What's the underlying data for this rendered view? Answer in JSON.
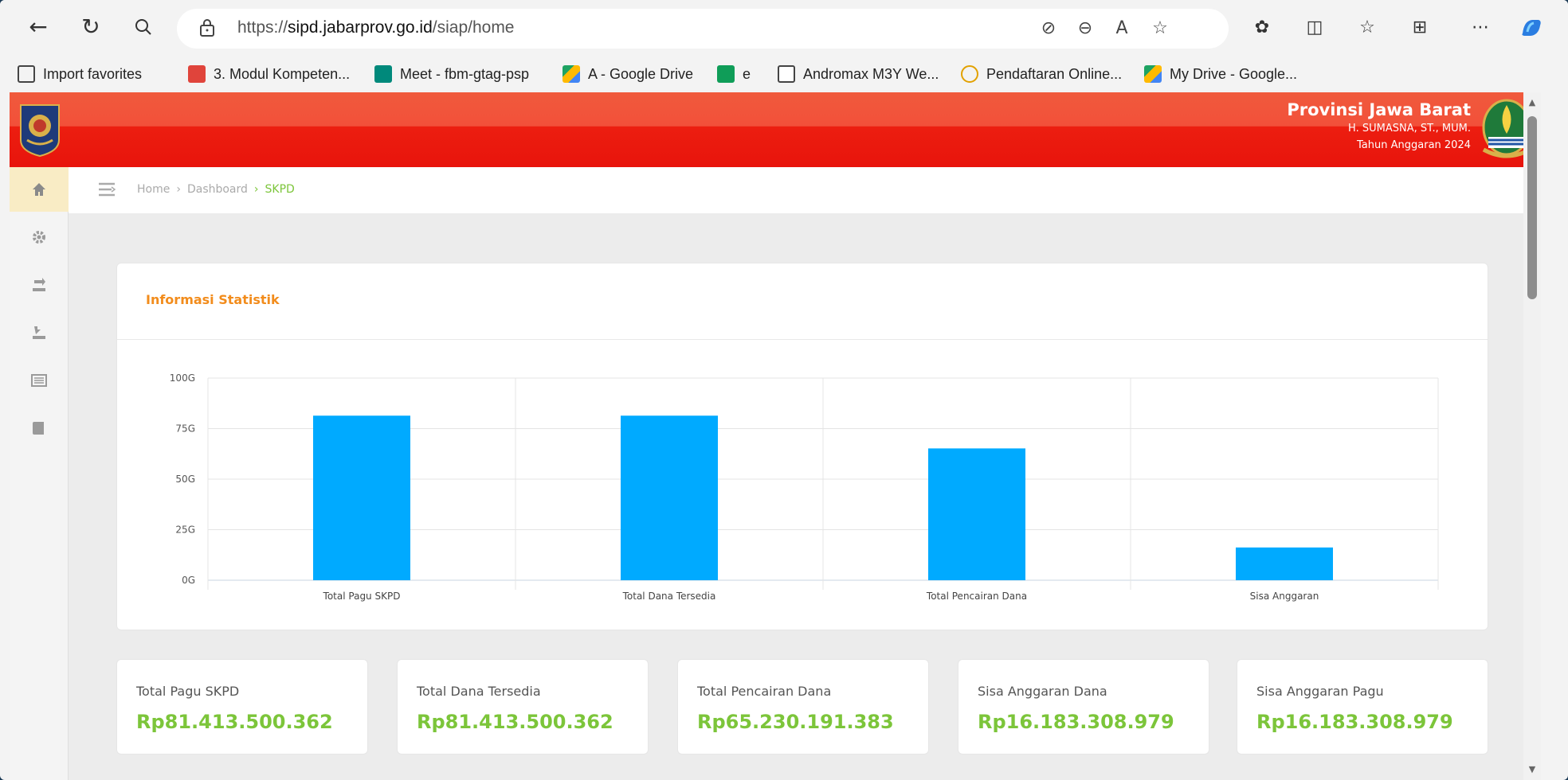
{
  "browser": {
    "url_prefix": "https://",
    "url_domain": "sipd.jabarprov.go.id",
    "url_path": "/siap/home",
    "bookmarks": [
      {
        "label": "Import favorites",
        "icon": "import-icon"
      },
      {
        "label": "3. Modul Kompeten...",
        "icon": "pdf-icon"
      },
      {
        "label": "Meet - fbm-gtag-psp",
        "icon": "meet-icon"
      },
      {
        "label": "A - Google Drive",
        "icon": "drive-icon"
      },
      {
        "label": "e",
        "icon": "sheets-icon"
      },
      {
        "label": "Andromax M3Y We...",
        "icon": "page-icon"
      },
      {
        "label": "Pendaftaran Online...",
        "icon": "site-icon"
      },
      {
        "label": "My Drive - Google...",
        "icon": "drive-icon"
      }
    ]
  },
  "header": {
    "province": "Provinsi Jawa Barat",
    "user": "H. SUMASNA, ST., MUM.",
    "fiscal_year": "Tahun Anggaran 2024"
  },
  "breadcrumb": {
    "home": "Home",
    "dashboard": "Dashboard",
    "current": "SKPD"
  },
  "stats_card": {
    "title": "Informasi Statistik"
  },
  "chart_data": {
    "type": "bar",
    "categories": [
      "Total Pagu SKPD",
      "Total Dana Tersedia",
      "Total Pencairan Dana",
      "Sisa Anggaran"
    ],
    "values": [
      81.4,
      81.4,
      65.2,
      16.2
    ],
    "value_unit": "G",
    "ylim": [
      0,
      100
    ],
    "yticks": [
      "0G",
      "25G",
      "50G",
      "75G",
      "100G"
    ],
    "ytick_values": [
      0,
      25,
      50,
      75,
      100
    ],
    "bar_color": "#00aaff",
    "grid": true
  },
  "stats": [
    {
      "label": "Total Pagu SKPD",
      "value": "Rp81.413.500.362"
    },
    {
      "label": "Total Dana Tersedia",
      "value": "Rp81.413.500.362"
    },
    {
      "label": "Total Pencairan Dana",
      "value": "Rp65.230.191.383"
    },
    {
      "label": "Sisa Anggaran Dana",
      "value": "Rp16.183.308.979"
    },
    {
      "label": "Sisa Anggaran Pagu",
      "value": "Rp16.183.308.979"
    }
  ],
  "colors": {
    "header_red": "#e8140c",
    "accent_green": "#7cc53a",
    "title_orange": "#f28c1c",
    "bar_blue": "#00aaff"
  }
}
